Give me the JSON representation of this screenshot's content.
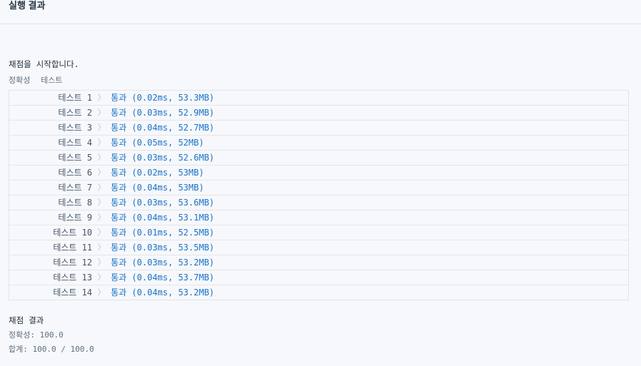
{
  "header": {
    "title": "실행 결과"
  },
  "console": {
    "start_message": "채점을 시작합니다.",
    "group_label": "정확성  테스트",
    "tests": [
      {
        "name": "테스트 1",
        "result": "통과 (0.02ms, 53.3MB)"
      },
      {
        "name": "테스트 2",
        "result": "통과 (0.03ms, 52.9MB)"
      },
      {
        "name": "테스트 3",
        "result": "통과 (0.04ms, 52.7MB)"
      },
      {
        "name": "테스트 4",
        "result": "통과 (0.05ms, 52MB)"
      },
      {
        "name": "테스트 5",
        "result": "통과 (0.03ms, 52.6MB)"
      },
      {
        "name": "테스트 6",
        "result": "통과 (0.02ms, 53MB)"
      },
      {
        "name": "테스트 7",
        "result": "통과 (0.04ms, 53MB)"
      },
      {
        "name": "테스트 8",
        "result": "통과 (0.03ms, 53.6MB)"
      },
      {
        "name": "테스트 9",
        "result": "통과 (0.04ms, 53.1MB)"
      },
      {
        "name": "테스트 10",
        "result": "통과 (0.01ms, 52.5MB)"
      },
      {
        "name": "테스트 11",
        "result": "통과 (0.03ms, 53.5MB)"
      },
      {
        "name": "테스트 12",
        "result": "통과 (0.03ms, 53.2MB)"
      },
      {
        "name": "테스트 13",
        "result": "통과 (0.04ms, 53.7MB)"
      },
      {
        "name": "테스트 14",
        "result": "통과 (0.04ms, 53.2MB)"
      }
    ],
    "chevron_icon": "chevron-right-icon",
    "summary": {
      "title": "채점 결과",
      "accuracy": "정확성: 100.0",
      "total": "합계: 100.0 / 100.0"
    }
  },
  "colors": {
    "pass": "#1a73c8",
    "background": "#f7f8fb"
  }
}
